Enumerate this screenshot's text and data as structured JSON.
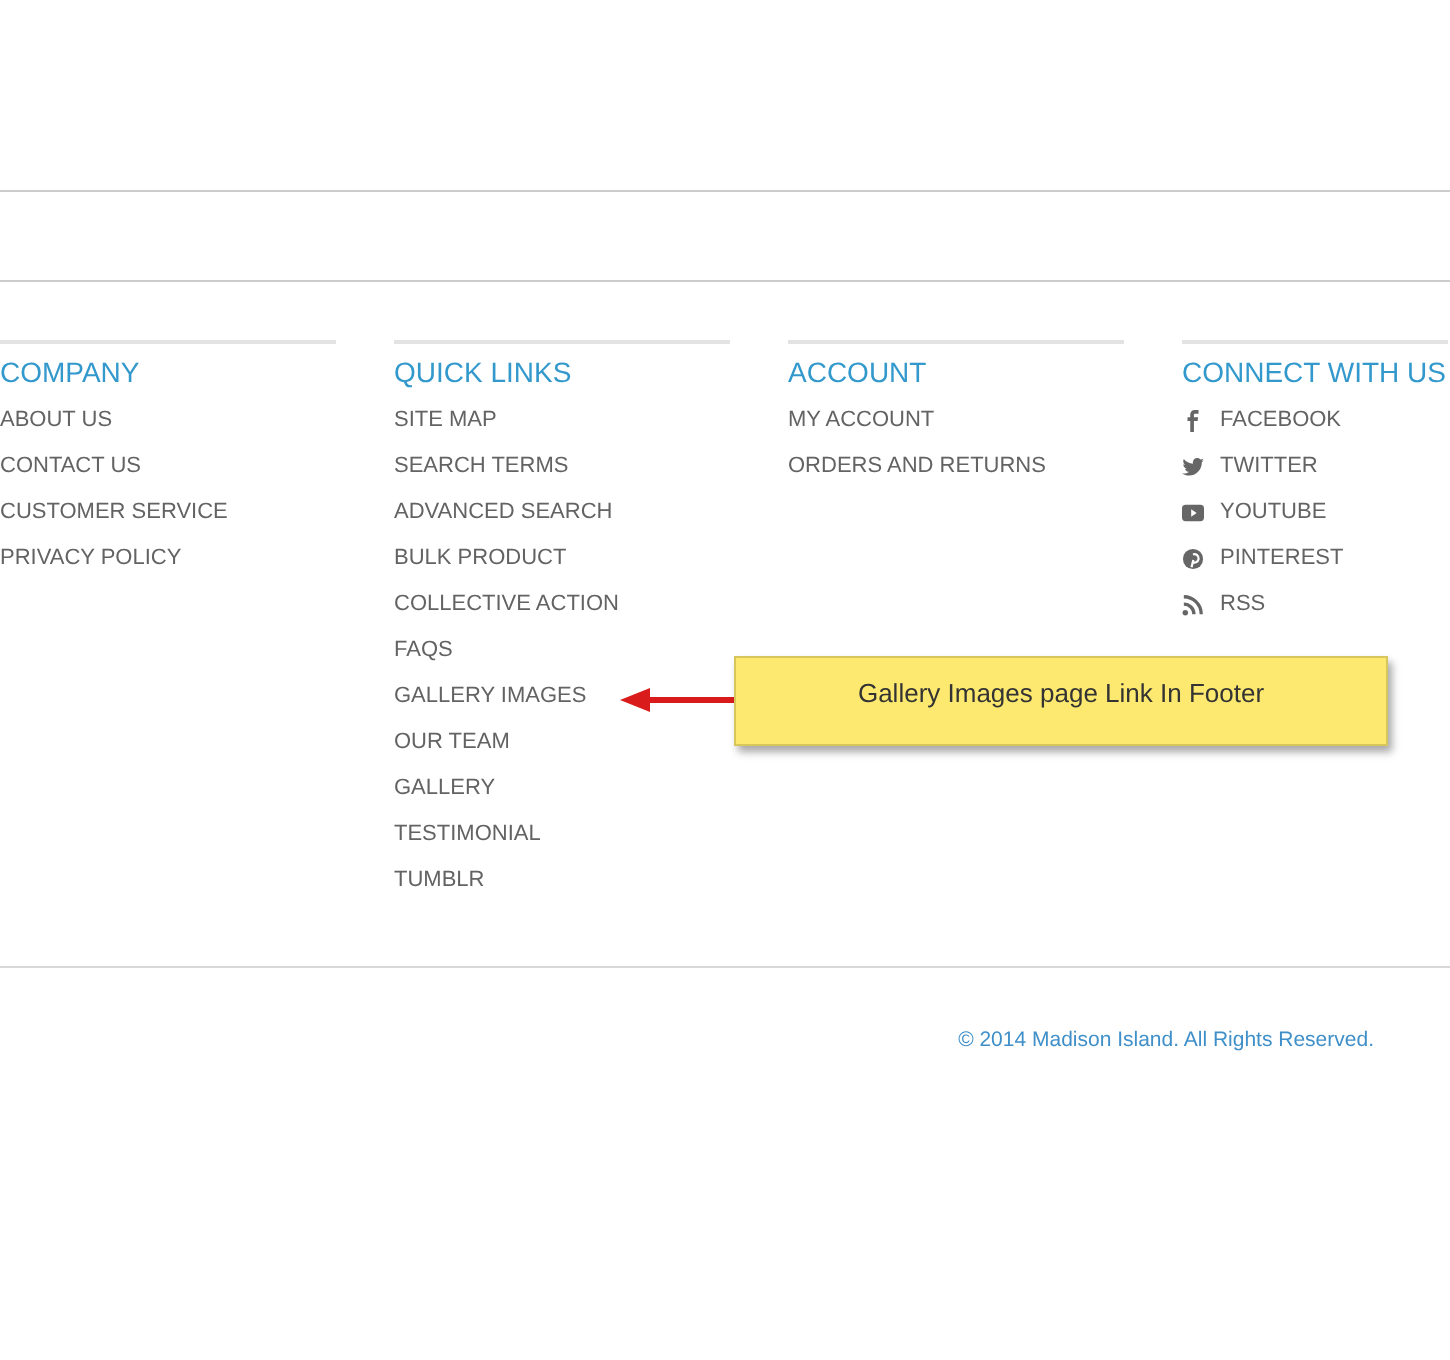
{
  "footer": {
    "columns": [
      {
        "heading": "COMPANY",
        "links": [
          "ABOUT US",
          "CONTACT US",
          "CUSTOMER SERVICE",
          "PRIVACY POLICY"
        ]
      },
      {
        "heading": "QUICK LINKS",
        "links": [
          "SITE MAP",
          "SEARCH TERMS",
          "ADVANCED SEARCH",
          "BULK PRODUCT",
          "COLLECTIVE ACTION",
          "FAQS",
          "GALLERY IMAGES",
          "OUR TEAM",
          "GALLERY",
          "TESTIMONIAL",
          "TUMBLR"
        ]
      },
      {
        "heading": "ACCOUNT",
        "links": [
          "MY ACCOUNT",
          "ORDERS AND RETURNS"
        ]
      },
      {
        "heading": "CONNECT WITH US",
        "links": [
          "FACEBOOK",
          "TWITTER",
          "YOUTUBE",
          "PINTEREST",
          "RSS"
        ]
      }
    ],
    "copyright": "© 2014 Madison Island. All Rights Reserved."
  },
  "callout": {
    "text": "Gallery Images page Link In Footer"
  }
}
